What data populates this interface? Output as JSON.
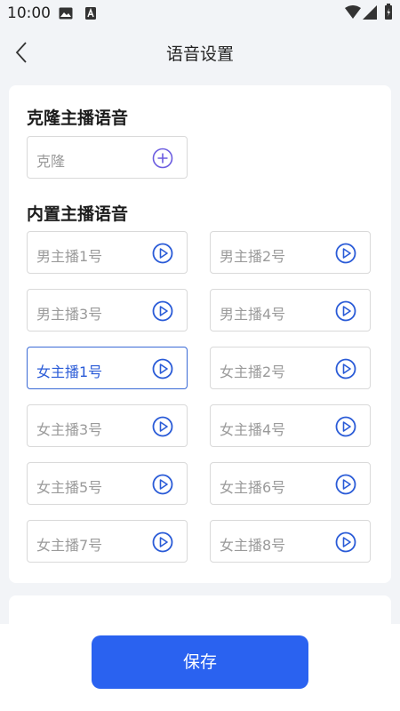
{
  "status_bar": {
    "time": "10:00"
  },
  "header": {
    "title": "语音设置"
  },
  "clone_section": {
    "title": "克隆主播语音",
    "clone_button_label": "克隆"
  },
  "builtin_section": {
    "title": "内置主播语音",
    "voices": [
      {
        "label": "男主播1号",
        "selected": false
      },
      {
        "label": "男主播2号",
        "selected": false
      },
      {
        "label": "男主播3号",
        "selected": false
      },
      {
        "label": "男主播4号",
        "selected": false
      },
      {
        "label": "女主播1号",
        "selected": true
      },
      {
        "label": "女主播2号",
        "selected": false
      },
      {
        "label": "女主播3号",
        "selected": false
      },
      {
        "label": "女主播4号",
        "selected": false
      },
      {
        "label": "女主播5号",
        "selected": false
      },
      {
        "label": "女主播6号",
        "selected": false
      },
      {
        "label": "女主播7号",
        "selected": false
      },
      {
        "label": "女主播8号",
        "selected": false
      }
    ]
  },
  "footer": {
    "save_label": "保存"
  },
  "colors": {
    "accent": "#2a62f0",
    "selected_text": "#2a5bd7",
    "tile_border": "#d9d9d9",
    "page_bg": "#f2f4f7"
  }
}
